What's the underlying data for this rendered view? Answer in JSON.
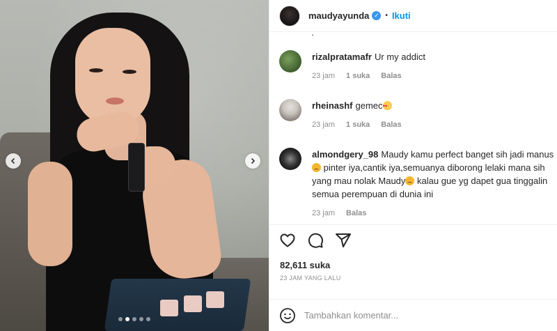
{
  "post": {
    "author": "maudyayunda",
    "follow_label": "Ikuti",
    "separator": "•",
    "clipped_text": "·",
    "carousel": {
      "slide_count": 5,
      "active_index": 1
    }
  },
  "comments": [
    {
      "username": "rizalpratamafr",
      "lines": [
        "Ur my addict"
      ],
      "time": "23 jam",
      "likes": "1 suka",
      "reply_label": "Balas"
    },
    {
      "username": "rheinashf",
      "lines": [
        "gemec"
      ],
      "time": "23 jam",
      "likes": "1 suka",
      "reply_label": "Balas"
    },
    {
      "username": "almondgery_98",
      "lines": [
        "Maudy kamu perfect banget sih jadi manus",
        " pinter iya,cantik iya,semuanya diborong lelaki mana sih",
        "yang mau nolak Maudy",
        " kalau gue yg dapet gua tinggalin",
        "semua perempuan di dunia ini"
      ],
      "time": "23 jam",
      "reply_label": "Balas"
    }
  ],
  "actions": {
    "likes_count": "82,611 suka",
    "timestamp": "23 JAM YANG LALU"
  },
  "composer": {
    "placeholder": "Tambahkan komentar..."
  },
  "colors": {
    "accent": "#0095f6",
    "verified": "#3897f0",
    "muted": "#8e8e8e",
    "text": "#262626"
  },
  "icons": [
    "verified-badge-icon",
    "heart-icon",
    "comment-icon",
    "share-icon",
    "emoji-icon",
    "chevron-left-icon",
    "chevron-right-icon"
  ]
}
